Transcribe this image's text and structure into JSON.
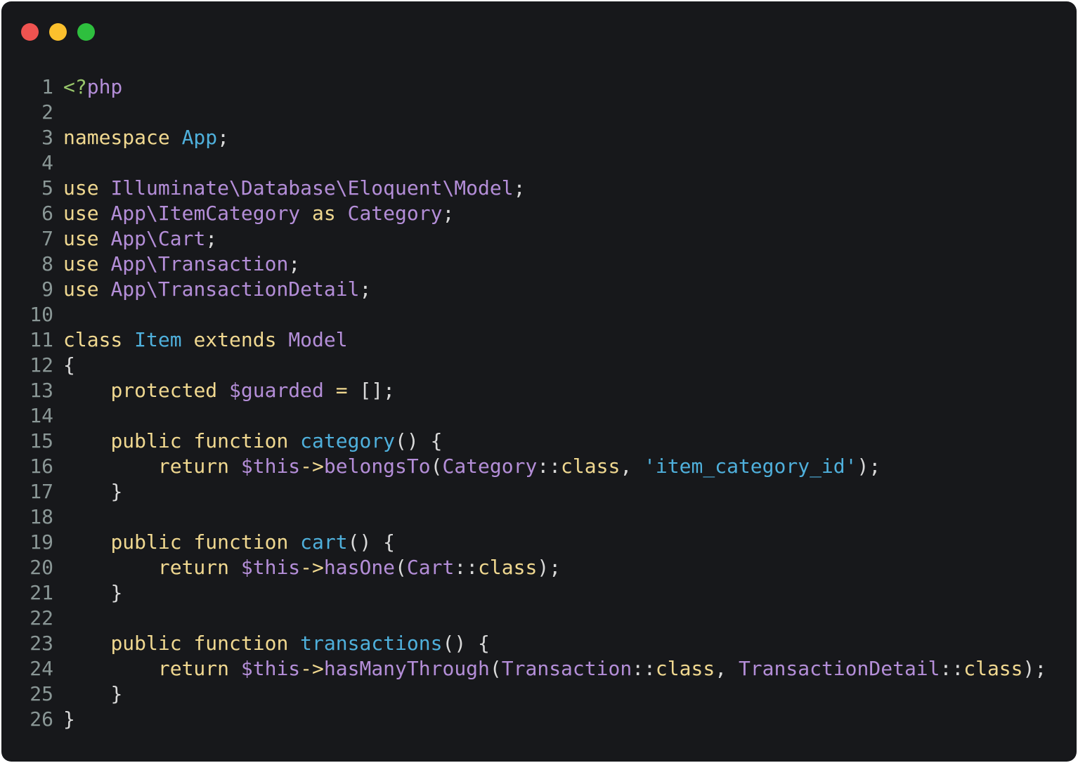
{
  "window": {
    "controls": [
      {
        "name": "close",
        "color": "#ef5350"
      },
      {
        "name": "minimize",
        "color": "#fbc02d"
      },
      {
        "name": "maximize",
        "color": "#2ebf3e"
      }
    ]
  },
  "colors": {
    "keyword": "#f0d890",
    "type": "#b48ed8",
    "func": "#4fb0dc",
    "string": "#4fb0dc",
    "punct": "#d9d9d9",
    "tag": "#99c76b",
    "line_number": "#8a9796"
  },
  "code": {
    "lines": [
      {
        "n": "1",
        "tokens": [
          [
            "<?",
            "tag"
          ],
          [
            "php",
            "type"
          ]
        ]
      },
      {
        "n": "2",
        "tokens": []
      },
      {
        "n": "3",
        "tokens": [
          [
            "namespace",
            "keyword"
          ],
          [
            " ",
            "punct"
          ],
          [
            "App",
            "func"
          ],
          [
            ";",
            "punct"
          ]
        ]
      },
      {
        "n": "4",
        "tokens": []
      },
      {
        "n": "5",
        "tokens": [
          [
            "use",
            "keyword"
          ],
          [
            " ",
            "punct"
          ],
          [
            "Illuminate\\Database\\Eloquent\\Model",
            "type"
          ],
          [
            ";",
            "punct"
          ]
        ]
      },
      {
        "n": "6",
        "tokens": [
          [
            "use",
            "keyword"
          ],
          [
            " ",
            "punct"
          ],
          [
            "App\\ItemCategory",
            "type"
          ],
          [
            " ",
            "punct"
          ],
          [
            "as",
            "keyword"
          ],
          [
            " ",
            "punct"
          ],
          [
            "Category",
            "type"
          ],
          [
            ";",
            "punct"
          ]
        ]
      },
      {
        "n": "7",
        "tokens": [
          [
            "use",
            "keyword"
          ],
          [
            " ",
            "punct"
          ],
          [
            "App\\Cart",
            "type"
          ],
          [
            ";",
            "punct"
          ]
        ]
      },
      {
        "n": "8",
        "tokens": [
          [
            "use",
            "keyword"
          ],
          [
            " ",
            "punct"
          ],
          [
            "App\\Transaction",
            "type"
          ],
          [
            ";",
            "punct"
          ]
        ]
      },
      {
        "n": "9",
        "tokens": [
          [
            "use",
            "keyword"
          ],
          [
            " ",
            "punct"
          ],
          [
            "App\\TransactionDetail",
            "type"
          ],
          [
            ";",
            "punct"
          ]
        ]
      },
      {
        "n": "10",
        "tokens": []
      },
      {
        "n": "11",
        "tokens": [
          [
            "class",
            "keyword"
          ],
          [
            " ",
            "punct"
          ],
          [
            "Item",
            "func"
          ],
          [
            " ",
            "punct"
          ],
          [
            "extends",
            "keyword"
          ],
          [
            " ",
            "punct"
          ],
          [
            "Model",
            "type"
          ]
        ]
      },
      {
        "n": "12",
        "tokens": [
          [
            "{",
            "punct"
          ]
        ]
      },
      {
        "n": "13",
        "tokens": [
          [
            "    ",
            "punct"
          ],
          [
            "protected",
            "keyword"
          ],
          [
            " ",
            "punct"
          ],
          [
            "$guarded",
            "type"
          ],
          [
            " ",
            "punct"
          ],
          [
            "=",
            "keyword"
          ],
          [
            " ",
            "punct"
          ],
          [
            "[];",
            "punct"
          ]
        ]
      },
      {
        "n": "14",
        "tokens": []
      },
      {
        "n": "15",
        "tokens": [
          [
            "    ",
            "punct"
          ],
          [
            "public",
            "keyword"
          ],
          [
            " ",
            "punct"
          ],
          [
            "function",
            "keyword"
          ],
          [
            " ",
            "punct"
          ],
          [
            "category",
            "func"
          ],
          [
            "() {",
            "punct"
          ]
        ]
      },
      {
        "n": "16",
        "tokens": [
          [
            "        ",
            "punct"
          ],
          [
            "return",
            "keyword"
          ],
          [
            " ",
            "punct"
          ],
          [
            "$this",
            "type"
          ],
          [
            "->",
            "keyword"
          ],
          [
            "belongsTo",
            "type"
          ],
          [
            "(",
            "punct"
          ],
          [
            "Category",
            "type"
          ],
          [
            "::",
            "punct"
          ],
          [
            "class",
            "keyword"
          ],
          [
            ", ",
            "punct"
          ],
          [
            "'item_category_id'",
            "string"
          ],
          [
            ");",
            "punct"
          ]
        ]
      },
      {
        "n": "17",
        "tokens": [
          [
            "    ",
            "punct"
          ],
          [
            "}",
            "punct"
          ]
        ]
      },
      {
        "n": "18",
        "tokens": []
      },
      {
        "n": "19",
        "tokens": [
          [
            "    ",
            "punct"
          ],
          [
            "public",
            "keyword"
          ],
          [
            " ",
            "punct"
          ],
          [
            "function",
            "keyword"
          ],
          [
            " ",
            "punct"
          ],
          [
            "cart",
            "func"
          ],
          [
            "() {",
            "punct"
          ]
        ]
      },
      {
        "n": "20",
        "tokens": [
          [
            "        ",
            "punct"
          ],
          [
            "return",
            "keyword"
          ],
          [
            " ",
            "punct"
          ],
          [
            "$this",
            "type"
          ],
          [
            "->",
            "keyword"
          ],
          [
            "hasOne",
            "type"
          ],
          [
            "(",
            "punct"
          ],
          [
            "Cart",
            "type"
          ],
          [
            "::",
            "punct"
          ],
          [
            "class",
            "keyword"
          ],
          [
            ");",
            "punct"
          ]
        ]
      },
      {
        "n": "21",
        "tokens": [
          [
            "    ",
            "punct"
          ],
          [
            "}",
            "punct"
          ]
        ]
      },
      {
        "n": "22",
        "tokens": []
      },
      {
        "n": "23",
        "tokens": [
          [
            "    ",
            "punct"
          ],
          [
            "public",
            "keyword"
          ],
          [
            " ",
            "punct"
          ],
          [
            "function",
            "keyword"
          ],
          [
            " ",
            "punct"
          ],
          [
            "transactions",
            "func"
          ],
          [
            "() {",
            "punct"
          ]
        ]
      },
      {
        "n": "24",
        "tokens": [
          [
            "        ",
            "punct"
          ],
          [
            "return",
            "keyword"
          ],
          [
            " ",
            "punct"
          ],
          [
            "$this",
            "type"
          ],
          [
            "->",
            "keyword"
          ],
          [
            "hasManyThrough",
            "type"
          ],
          [
            "(",
            "punct"
          ],
          [
            "Transaction",
            "type"
          ],
          [
            "::",
            "punct"
          ],
          [
            "class",
            "keyword"
          ],
          [
            ", ",
            "punct"
          ],
          [
            "TransactionDetail",
            "type"
          ],
          [
            "::",
            "punct"
          ],
          [
            "class",
            "keyword"
          ],
          [
            ");",
            "punct"
          ]
        ]
      },
      {
        "n": "25",
        "tokens": [
          [
            "    ",
            "punct"
          ],
          [
            "}",
            "punct"
          ]
        ]
      },
      {
        "n": "26",
        "tokens": [
          [
            "}",
            "punct"
          ]
        ]
      }
    ]
  }
}
